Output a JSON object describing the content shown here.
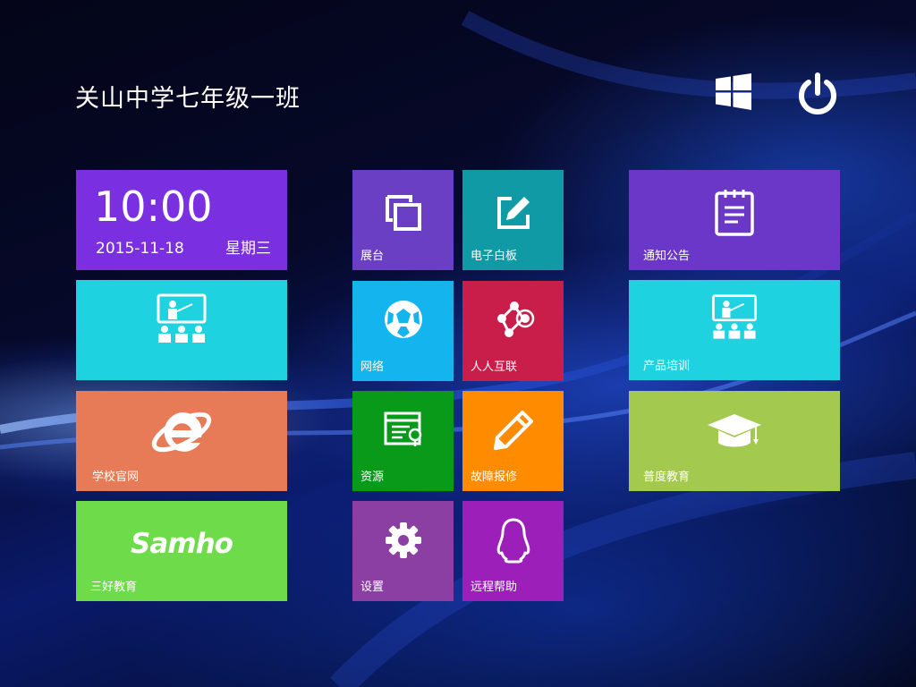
{
  "header": {
    "title": "关山中学七年级一班",
    "windows_icon": "windows-logo-icon",
    "power_icon": "power-icon"
  },
  "clock": {
    "time": "10:00",
    "date": "2015-11-18",
    "weekday": "星期三",
    "color": "#7a2fe0"
  },
  "tiles": {
    "training_left": {
      "label": "",
      "icon": "presentation-icon",
      "color": "#1fd2e0"
    },
    "school_site": {
      "label": "学校官网",
      "icon": "internet-explorer-icon",
      "color": "#e87b57"
    },
    "sanhao": {
      "label": "三好教育",
      "logo_text": "Samho",
      "color": "#6edc4a"
    },
    "display": {
      "label": "展台",
      "icon": "display-copy-icon",
      "color": "#6b3fc4"
    },
    "whiteboard": {
      "label": "电子白板",
      "icon": "edit-board-icon",
      "color": "#0f9aa6"
    },
    "network": {
      "label": "网络",
      "icon": "globe-ball-icon",
      "color": "#14b4ee"
    },
    "renren": {
      "label": "人人互联",
      "icon": "share-network-icon",
      "color": "#c91e4a"
    },
    "resources": {
      "label": "资源",
      "icon": "resource-browser-icon",
      "color": "#0a9a1a"
    },
    "repair": {
      "label": "故障报修",
      "icon": "pencil-icon",
      "color": "#ff8c00"
    },
    "settings": {
      "label": "设置",
      "icon": "gear-icon",
      "color": "#8c3fa3"
    },
    "remote_help": {
      "label": "远程帮助",
      "icon": "qq-penguin-icon",
      "color": "#9b1fb8"
    },
    "notice": {
      "label": "通知公告",
      "icon": "notepad-icon",
      "color": "#6a37c8"
    },
    "product_training": {
      "label": "产品培训",
      "icon": "presentation-icon",
      "color": "#1fd2e0"
    },
    "puedu": {
      "label": "普度教育",
      "icon": "graduation-cap-icon",
      "color": "#a3c94e"
    }
  }
}
